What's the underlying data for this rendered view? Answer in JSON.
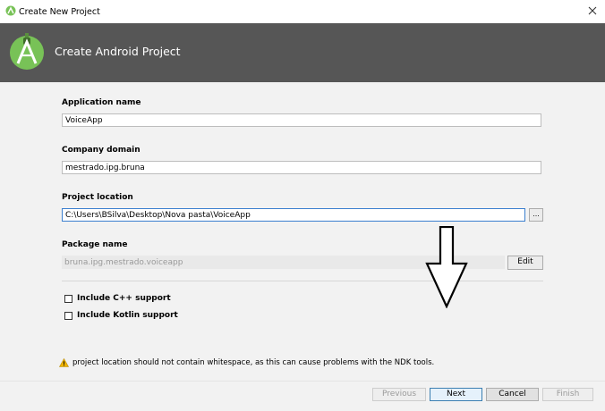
{
  "window": {
    "title": "Create New Project"
  },
  "header": {
    "title": "Create Android Project"
  },
  "form": {
    "application_name": {
      "label": "Application name",
      "value": "VoiceApp"
    },
    "company_domain": {
      "label": "Company domain",
      "value": "mestrado.ipg.bruna"
    },
    "project_location": {
      "label": "Project location",
      "value": "C:\\Users\\BSilva\\Desktop\\Nova pasta\\VoiceApp",
      "browse_label": "..."
    },
    "package_name": {
      "label": "Package name",
      "value": "bruna.ipg.mestrado.voiceapp",
      "edit_label": "Edit"
    },
    "include_cpp": {
      "label": "Include C++ support",
      "checked": false
    },
    "include_kotlin": {
      "label": "Include Kotlin support",
      "checked": false
    }
  },
  "warning": {
    "text": "project location should not contain whitespace, as this can cause problems with the NDK tools.",
    "icon": "warning-icon"
  },
  "buttons": {
    "previous": "Previous",
    "next": "Next",
    "cancel": "Cancel",
    "finish": "Finish"
  },
  "colors": {
    "header_bg": "#565656",
    "android_green": "#78c257",
    "focus_border": "#3b7fcf"
  }
}
